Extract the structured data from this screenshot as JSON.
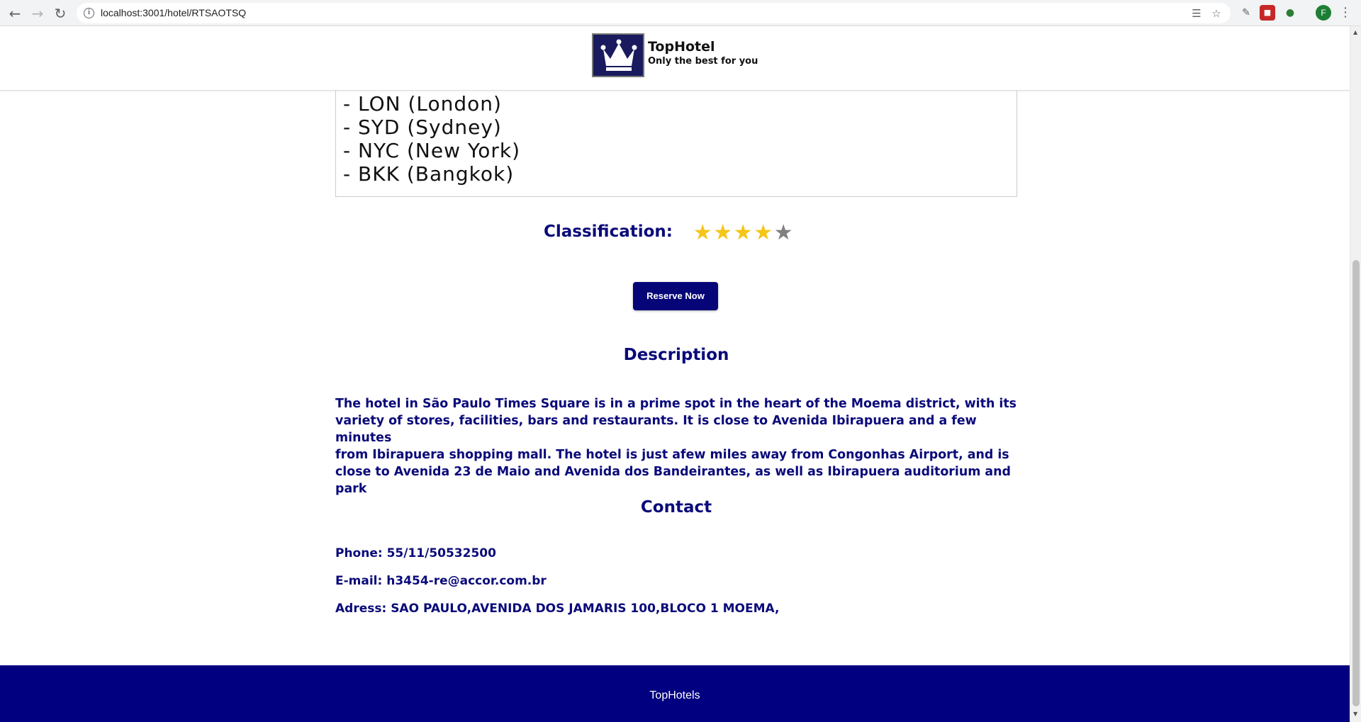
{
  "browser": {
    "url": "localhost:3001/hotel/RTSAOTSQ",
    "profile_initial": "F",
    "icons": {
      "back": "arrow-back-icon",
      "forward": "arrow-forward-icon",
      "reload": "reload-icon",
      "info": "info-icon",
      "translate": "translate-icon",
      "bookmark": "star-bookmark-icon",
      "menu": "kebab-menu-icon"
    }
  },
  "header": {
    "logo_title": "TopHotel",
    "logo_subtitle": "Only the best for you"
  },
  "map_panel": {
    "lines": [
      "- LON (London)",
      "- SYD (Sydney)",
      "- NYC (New York)",
      "- BKK (Bangkok)"
    ]
  },
  "classification": {
    "label": "Classification:",
    "rating": 4,
    "max": 5,
    "filled_color": "#f5c518",
    "empty_color": "#808080"
  },
  "reserve_button": {
    "label": "Reserve Now"
  },
  "description": {
    "heading": "Description",
    "lines": [
      "The hotel in São Paulo Times Square is in a prime spot in the heart of the Moema district, with its",
      "variety of stores, facilities, bars and restaurants. It is close to Avenida Ibirapuera and a few minutes",
      "from Ibirapuera shopping mall. The hotel is just afew miles away from Congonhas Airport, and is",
      "close to Avenida 23 de Maio and Avenida dos Bandeirantes, as well as Ibirapuera auditorium and park"
    ]
  },
  "contact": {
    "heading": "Contact",
    "phone": "Phone: 55/11/50532500",
    "email": "E-mail: h3454-re@accor.com.br",
    "address": "Adress: SAO PAULO,AVENIDA DOS JAMARIS 100,BLOCO 1 MOEMA,"
  },
  "footer": {
    "text": "TopHotels"
  },
  "colors": {
    "brand_navy": "#000080",
    "heading_text": "#0a0a7a"
  }
}
